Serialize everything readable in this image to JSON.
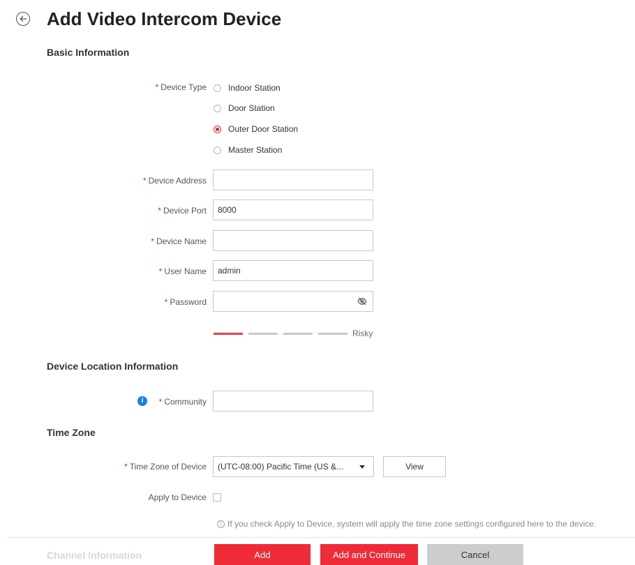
{
  "page": {
    "title": "Add Video Intercom Device"
  },
  "sections": {
    "basic": "Basic Information",
    "location": "Device Location Information",
    "timezone": "Time Zone",
    "channel": "Channel Information"
  },
  "required_marker": "*",
  "device_type": {
    "label": "Device Type",
    "options": [
      "Indoor Station",
      "Door Station",
      "Outer Door Station",
      "Master Station"
    ],
    "selected": "Outer Door Station"
  },
  "fields": {
    "address": {
      "label": "Device Address",
      "value": ""
    },
    "port": {
      "label": "Device Port",
      "value": "8000"
    },
    "name": {
      "label": "Device Name",
      "value": ""
    },
    "username": {
      "label": "User Name",
      "value": "admin"
    },
    "password": {
      "label": "Password",
      "value": ""
    }
  },
  "password_strength": {
    "label": "Risky",
    "level": 1,
    "segments": 4
  },
  "community": {
    "label": "Community",
    "value": ""
  },
  "time_zone": {
    "label": "Time Zone of Device",
    "selected": "(UTC-08:00) Pacific Time (US &...",
    "view_label": "View"
  },
  "apply_to_device": {
    "label": "Apply to Device",
    "checked": false,
    "hint": "If you check Apply to Device, system will apply the time zone settings configured here to the device."
  },
  "buttons": {
    "add": "Add",
    "add_continue": "Add and Continue",
    "cancel": "Cancel"
  },
  "icons": {
    "back": "back-arrow-circle-icon",
    "eye": "eye-hidden-icon",
    "info": "info-icon",
    "dropdown": "caret-down-icon"
  },
  "colors": {
    "accent": "#ee2b37",
    "info": "#1a7ee0"
  }
}
